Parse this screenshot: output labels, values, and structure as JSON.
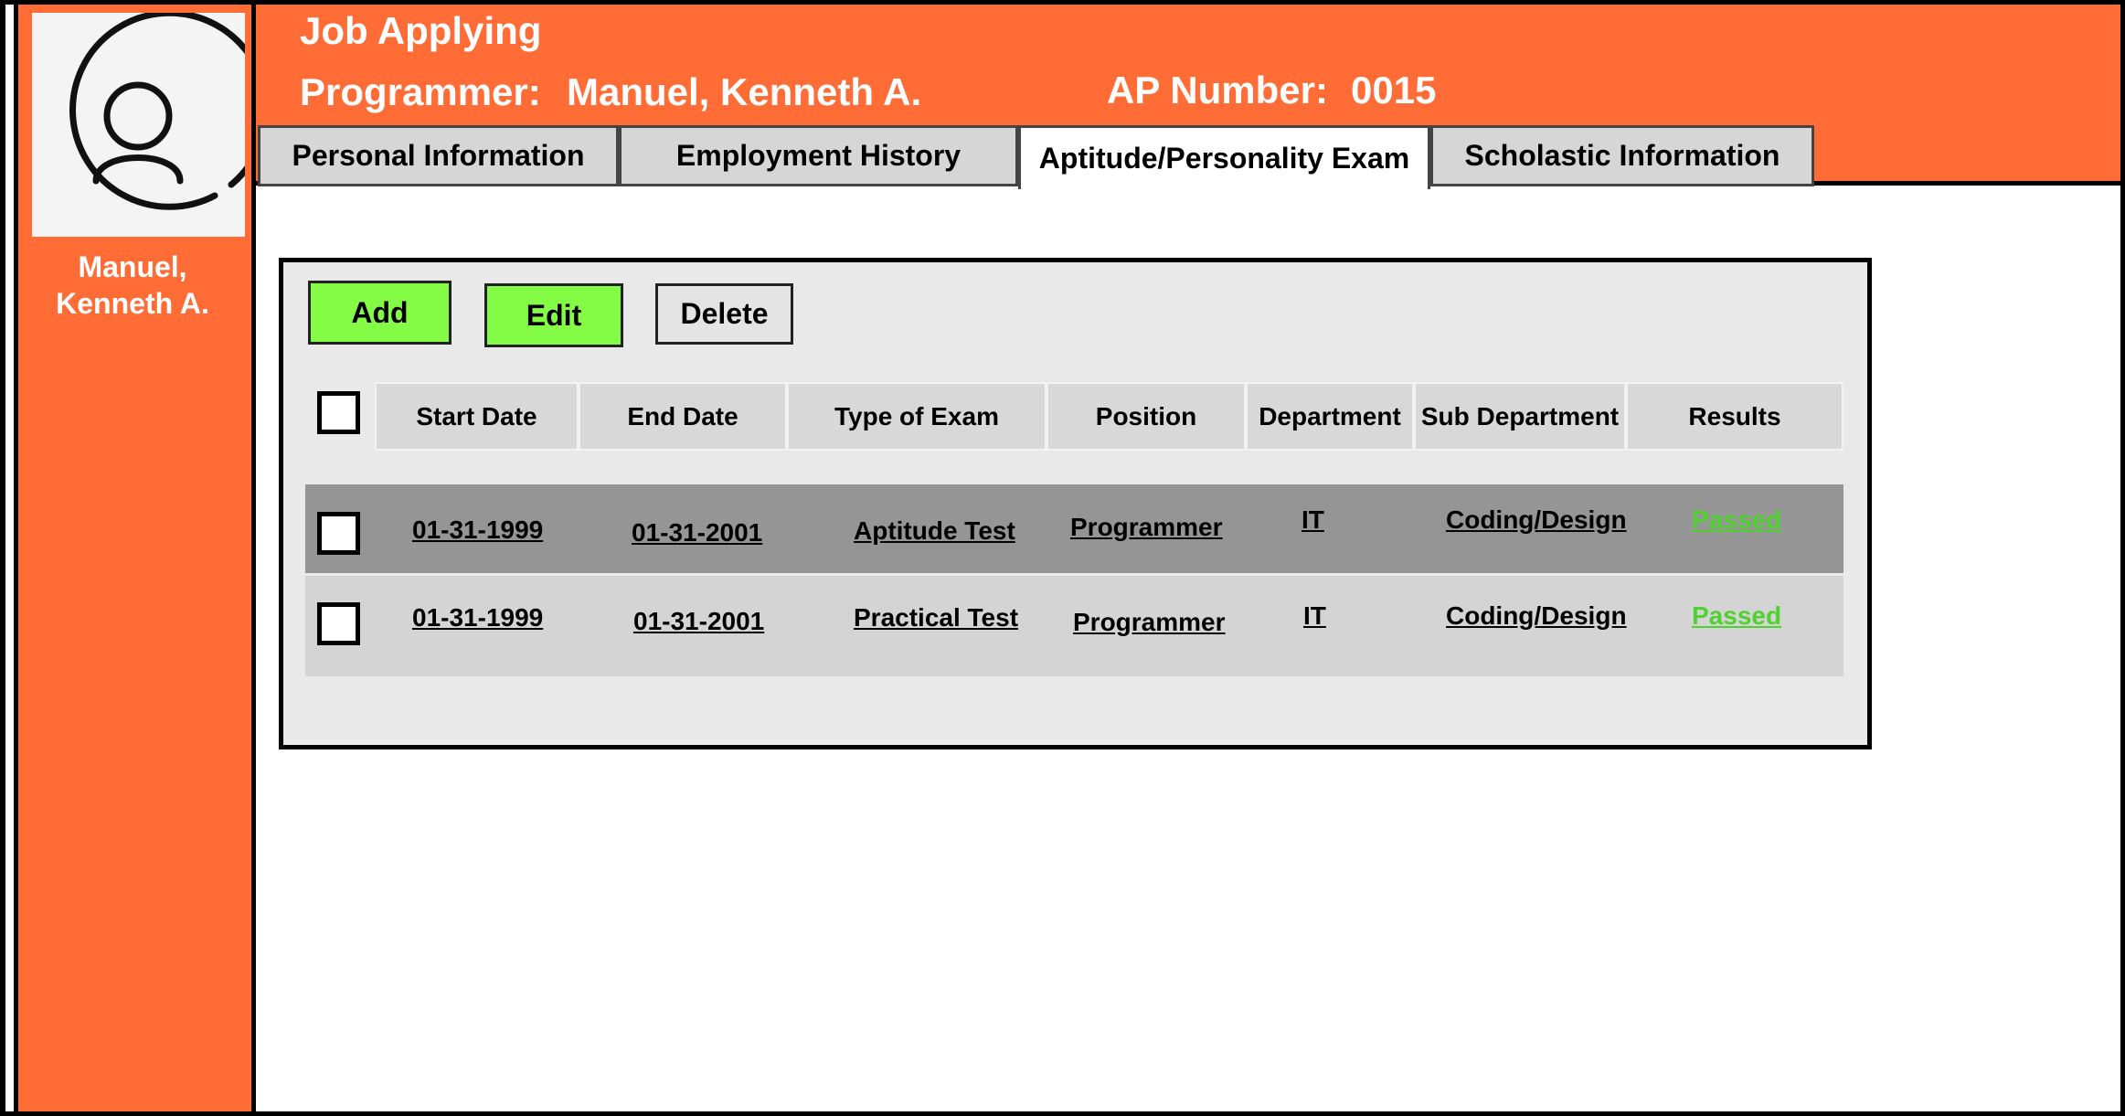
{
  "app": {
    "title": "Job Applying"
  },
  "profile": {
    "programmer_label": "Programmer:",
    "programmer_name": "Manuel, Kenneth A.",
    "ap_label": "AP Number:",
    "ap_number": "0015",
    "sidebar_name_line1": "Manuel,",
    "sidebar_name_line2": "Kenneth A."
  },
  "tabs": [
    {
      "label": "Personal Information",
      "active": false
    },
    {
      "label": "Employment History",
      "active": false
    },
    {
      "label": "Aptitude/Personality Exam",
      "active": true
    },
    {
      "label": "Scholastic Information",
      "active": false
    }
  ],
  "toolbar": {
    "add_label": "Add",
    "edit_label": "Edit",
    "delete_label": "Delete"
  },
  "table": {
    "columns": [
      "Start Date",
      "End Date",
      "Type of Exam",
      "Position",
      "Department",
      "Sub Department",
      "Results"
    ],
    "rows": [
      {
        "start": "01-31-1999",
        "end": "01-31-2001",
        "type": "Aptitude Test",
        "position": "Programmer",
        "department": "IT",
        "subdepartment": "Coding/Design",
        "result": "Passed"
      },
      {
        "start": "01-31-1999",
        "end": "01-31-2001",
        "type": "Practical Test",
        "position": "Programmer",
        "department": "IT",
        "subdepartment": "Coding/Design",
        "result": "Passed"
      }
    ]
  },
  "colors": {
    "accent": "#ff6c36",
    "button_green": "#84fb44",
    "result_green": "#4fd12f"
  },
  "icons": {
    "avatar": "user-avatar-icon"
  }
}
